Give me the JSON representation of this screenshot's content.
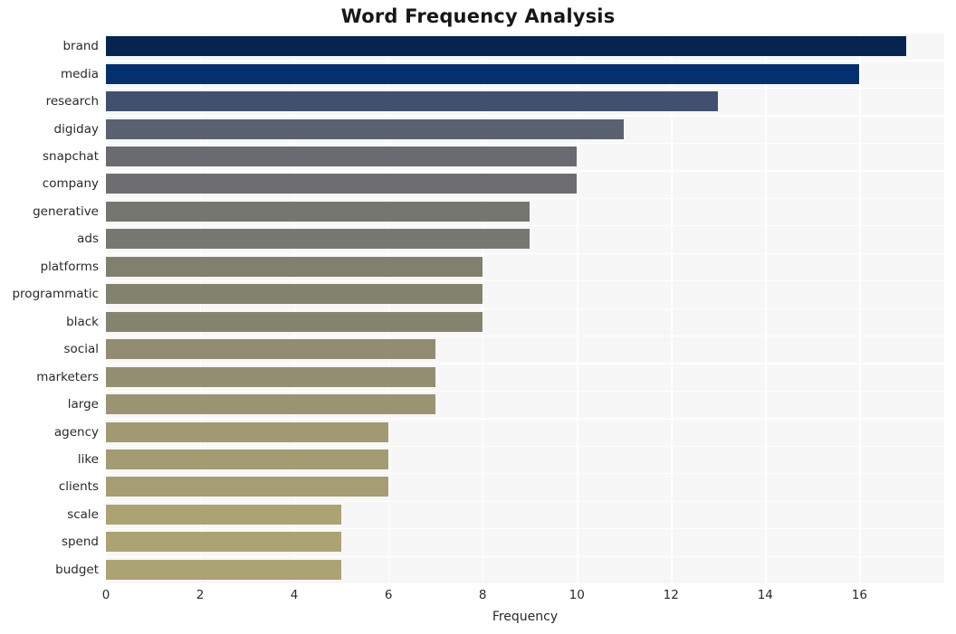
{
  "chart_data": {
    "type": "bar",
    "orientation": "horizontal",
    "title": "Word Frequency Analysis",
    "xlabel": "Frequency",
    "ylabel": "",
    "categories": [
      "brand",
      "media",
      "research",
      "digiday",
      "snapchat",
      "company",
      "generative",
      "ads",
      "platforms",
      "programmatic",
      "black",
      "social",
      "marketers",
      "large",
      "agency",
      "like",
      "clients",
      "scale",
      "spend",
      "budget"
    ],
    "values": [
      17,
      16,
      13,
      11,
      10,
      10,
      9,
      9,
      8,
      8,
      8,
      7,
      7,
      7,
      6,
      6,
      6,
      5,
      5,
      5
    ],
    "bar_colors": [
      "#05244f",
      "#04306e",
      "#41506e",
      "#5a6170",
      "#6a6b70",
      "#6e6e70",
      "#767671",
      "#787873",
      "#80806f",
      "#83826f",
      "#85846f",
      "#928d72",
      "#948f72",
      "#9a9473",
      "#a19a73",
      "#a39c73",
      "#a59e73",
      "#aba372",
      "#aba372",
      "#aba372"
    ],
    "xlim": [
      0,
      17.8
    ],
    "xticks": [
      0,
      2,
      4,
      6,
      8,
      10,
      12,
      14,
      16
    ],
    "xticklabels": [
      "0",
      "2",
      "4",
      "6",
      "8",
      "10",
      "12",
      "14",
      "16"
    ],
    "grid": true,
    "grid_color": "#ffffff",
    "plot_background": "#f7f7f7",
    "figure_background": "#ffffff",
    "legend": null,
    "style": "seaborn-whitegrid"
  }
}
